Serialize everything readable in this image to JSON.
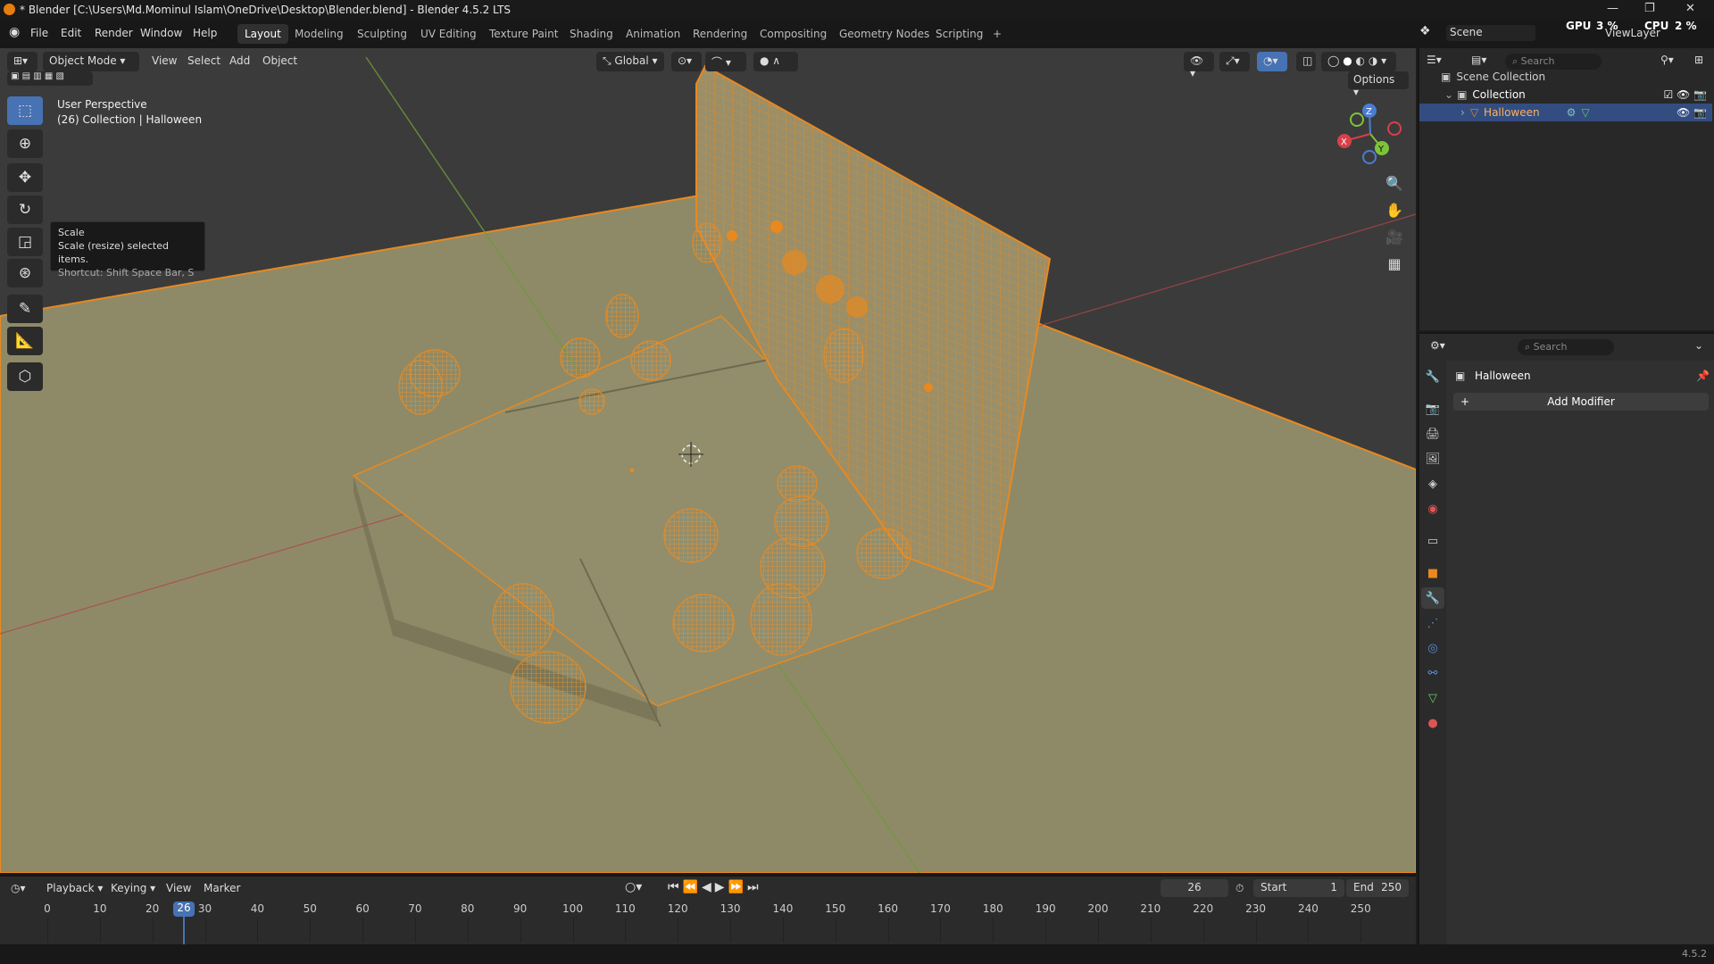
{
  "window": {
    "title": "* Blender [C:\\Users\\Md.Mominul Islam\\OneDrive\\Desktop\\Blender.blend] - Blender 4.5.2 LTS"
  },
  "menu": [
    "File",
    "Edit",
    "Render",
    "Window",
    "Help"
  ],
  "workspaces": [
    "Layout",
    "Modeling",
    "Sculpting",
    "UV Editing",
    "Texture Paint",
    "Shading",
    "Animation",
    "Rendering",
    "Compositing",
    "Geometry Nodes",
    "Scripting",
    "+"
  ],
  "top_right": {
    "scene": "Scene",
    "view_layer": "ViewLayer",
    "gpu": "GPU",
    "gpu_value": "3 %",
    "cpu": "CPU",
    "cpu_value": "2 %"
  },
  "viewport_header": {
    "mode": "Object Mode",
    "menus": [
      "View",
      "Select",
      "Add",
      "Object"
    ],
    "orientation": "Global",
    "options": "Options"
  },
  "viewport": {
    "perspective": "User Perspective",
    "collection": "(26) Collection | Halloween"
  },
  "tooltip": {
    "title": "Scale",
    "desc": "Scale (resize) selected items.",
    "shortcut": "Shortcut: Shift Space Bar, S"
  },
  "gizmo": {
    "x": "X",
    "y": "Y",
    "z": "Z"
  },
  "outliner": {
    "search": "Search",
    "scene_collection": "Scene Collection",
    "collection": "Collection",
    "object": "Halloween"
  },
  "properties": {
    "search": "Search",
    "object": "Halloween",
    "add_modifier": "Add Modifier",
    "tabs": [
      "tool",
      "render",
      "output",
      "view-layer",
      "scene",
      "world",
      "collection",
      "object",
      "modifiers",
      "particles",
      "physics",
      "constraints",
      "data",
      "material"
    ]
  },
  "timeline": {
    "menus": [
      "Playback",
      "Keying",
      "View",
      "Marker"
    ],
    "current_frame": "26",
    "start_label": "Start",
    "start": "1",
    "end_label": "End",
    "end": "250",
    "ticks": [
      "0",
      "10",
      "20",
      "26",
      "30",
      "40",
      "50",
      "60",
      "70",
      "80",
      "90",
      "100",
      "110",
      "120",
      "130",
      "140",
      "150",
      "160",
      "170",
      "180",
      "190",
      "200",
      "210",
      "220",
      "230",
      "240",
      "250"
    ]
  },
  "status": {
    "version": "4.5.2"
  },
  "colors": {
    "selection": "#e8891f",
    "accent": "#4772b3",
    "ground": "#8f8a68",
    "background": "#3a3a3a"
  }
}
